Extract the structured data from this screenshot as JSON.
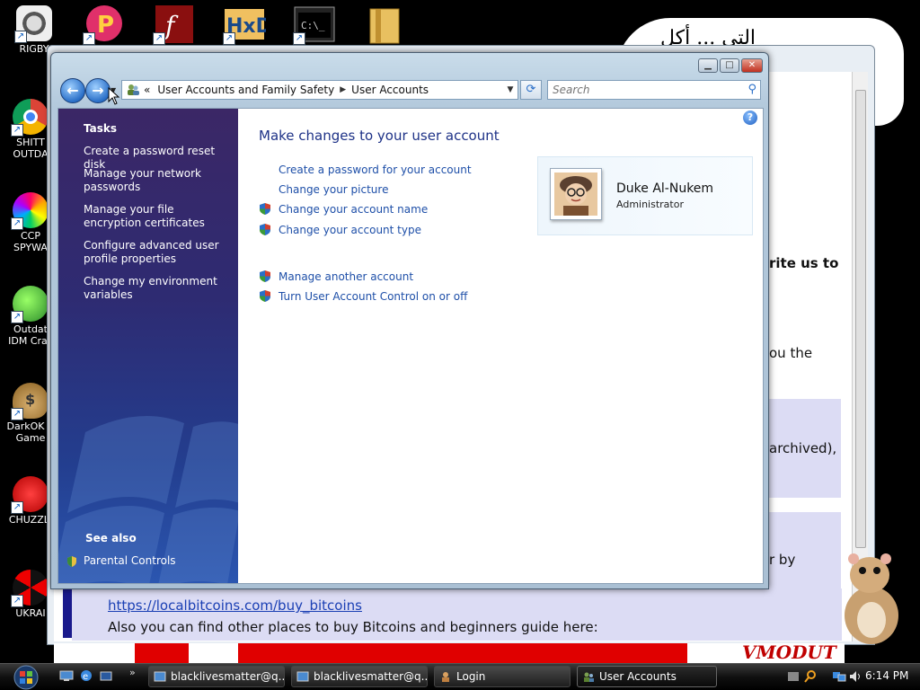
{
  "desktop": {
    "icons": [
      {
        "label": "RIGBY",
        "icon": "raccoon-icon"
      },
      {
        "label": "SHITT\nOUTDA",
        "icon": "chrome-icon"
      },
      {
        "label": "CCP\nSPYWA",
        "icon": "pinwheel-icon"
      },
      {
        "label": "Outdat\nIDM Crac",
        "icon": "download-manager-icon"
      },
      {
        "label": "DarkOK V\nGame",
        "icon": "money-bag-icon"
      },
      {
        "label": "CHUZZLI",
        "icon": "chuzzle-icon"
      },
      {
        "label": "UKRAI",
        "icon": "radiation-icon"
      }
    ],
    "speech_text": "التي ... أكل"
  },
  "background_window": {
    "fragments": {
      "write_us": "rite us to",
      "you_the": "ou the",
      "archived": "archived),",
      "by": "r by"
    },
    "link": "https://localbitcoins.com/buy_bitcoins",
    "line": "Also you can find other places to buy Bitcoins and beginners guide here:",
    "banner_text": "VMODUT"
  },
  "window": {
    "controls": {
      "minimize": "▁",
      "maximize": "□",
      "close": "✕"
    },
    "address": {
      "prefix": "«",
      "crumbs": [
        "User Accounts and Family Safety",
        "User Accounts"
      ],
      "separator": "▶",
      "dropdown": "▼"
    },
    "search": {
      "placeholder": "Search"
    },
    "sidebar": {
      "tasks_heading": "Tasks",
      "tasks": [
        "Create a password reset disk",
        "Manage your network passwords",
        "Manage your file encryption certificates",
        "Configure advanced user profile properties",
        "Change my environment variables"
      ],
      "see_also_heading": "See also",
      "see_also": [
        "Parental Controls"
      ]
    },
    "main": {
      "title": "Make changes to your user account",
      "help": "?",
      "tasks": [
        "Create a password for your account",
        "Change your picture",
        "Change your account name",
        "Change your account type"
      ],
      "other_tasks": [
        "Manage another account",
        "Turn User Account Control on or off"
      ],
      "user": {
        "name": "Duke Al-Nukem",
        "role": "Administrator"
      }
    }
  },
  "taskbar": {
    "buttons": [
      {
        "label": "blacklivesmatter@q...",
        "active": false
      },
      {
        "label": "blacklivesmatter@q...",
        "active": false
      },
      {
        "label": "Login",
        "active": false
      },
      {
        "label": "User Accounts",
        "active": true
      }
    ],
    "clock": "6:14 PM"
  },
  "colors": {
    "link": "#1e4fa8",
    "title": "#1e3287",
    "sidebar": "#2e2b72"
  }
}
